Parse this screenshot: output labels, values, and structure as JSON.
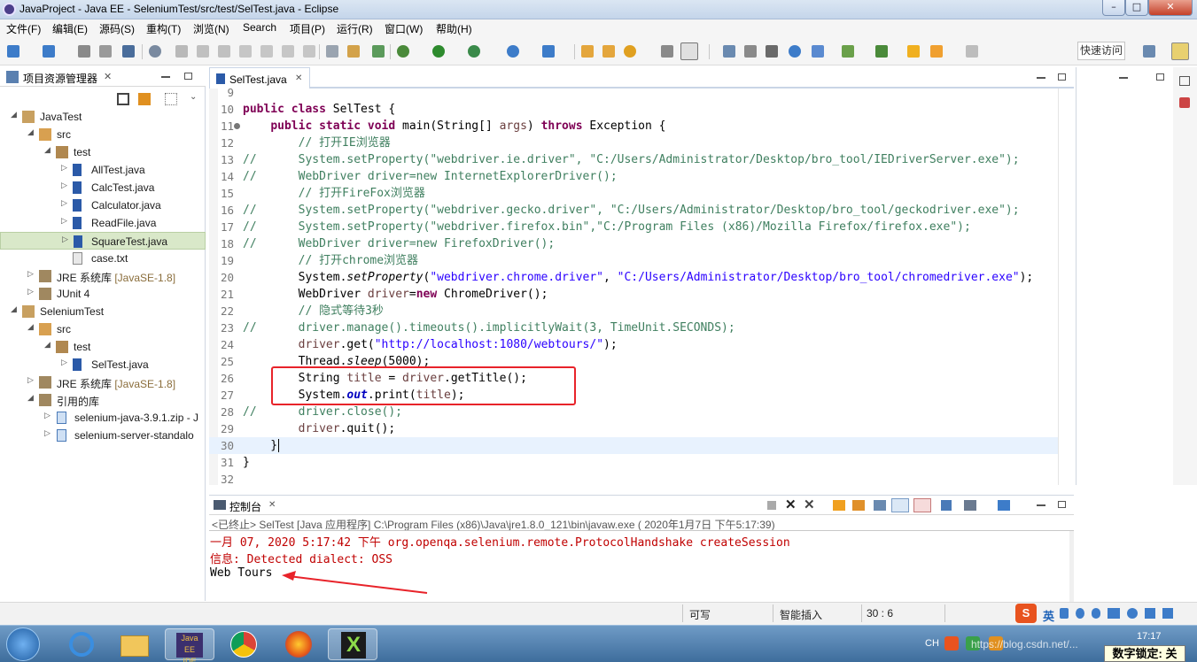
{
  "window": {
    "title": "JavaProject - Java EE - SeleniumTest/src/test/SelTest.java - Eclipse",
    "min_glyph": "–",
    "max_glyph": "□",
    "close_glyph": "✕"
  },
  "menubar": {
    "items": [
      "文件(F)",
      "编辑(E)",
      "源码(S)",
      "重构(T)",
      "浏览(N)",
      "Search",
      "项目(P)",
      "运行(R)",
      "窗口(W)",
      "帮助(H)"
    ]
  },
  "toolbar": {
    "quick_access_label": "快速访问"
  },
  "explorer": {
    "title": "项目资源管理器",
    "close_glyph": "✕",
    "rows": [
      {
        "label": "JavaTest",
        "suffix": ""
      },
      {
        "label": "src",
        "suffix": ""
      },
      {
        "label": "test",
        "suffix": ""
      },
      {
        "label": "AllTest.java",
        "suffix": ""
      },
      {
        "label": "CalcTest.java",
        "suffix": ""
      },
      {
        "label": "Calculator.java",
        "suffix": ""
      },
      {
        "label": "ReadFile.java",
        "suffix": ""
      },
      {
        "label": "SquareTest.java",
        "suffix": ""
      },
      {
        "label": "case.txt",
        "suffix": ""
      },
      {
        "label": "JRE 系统库 ",
        "suffix": "[JavaSE-1.8]"
      },
      {
        "label": "JUnit 4",
        "suffix": ""
      },
      {
        "label": "SeleniumTest",
        "suffix": ""
      },
      {
        "label": "src",
        "suffix": ""
      },
      {
        "label": "test",
        "suffix": ""
      },
      {
        "label": "SelTest.java",
        "suffix": ""
      },
      {
        "label": "JRE 系统库 ",
        "suffix": "[JavaSE-1.8]"
      },
      {
        "label": "引用的库",
        "suffix": ""
      },
      {
        "label": "selenium-java-3.9.1.zip - J",
        "suffix": ""
      },
      {
        "label": "selenium-server-standalo",
        "suffix": ""
      }
    ]
  },
  "editor": {
    "tab_label": "SelTest.java",
    "close_glyph": "✕",
    "line_numbers": [
      "9",
      "10",
      "11",
      "12",
      "13",
      "14",
      "15",
      "16",
      "17",
      "18",
      "19",
      "20",
      "21",
      "22",
      "23",
      "24",
      "25",
      "26",
      "27",
      "28",
      "29",
      "30",
      "31",
      "32"
    ],
    "code": {
      "l10_kw": "public class ",
      "l10_rest": "SelTest {",
      "l11_indent": "    ",
      "l11_kw": "public static void ",
      "l11_rest": "main(String[] ",
      "l11_var": "args",
      "l11_paren": ") ",
      "l11_kw2": "throws ",
      "l11_end": "Exception {",
      "l12_cm": "        // 打开IE浏览器",
      "l13_cm": "//      System.setProperty(\"webdriver.ie.driver\", \"C:/Users/Administrator/Desktop/bro_tool/IEDriverServer.exe\");",
      "l14_cm": "//      WebDriver driver=new InternetExplorerDriver();",
      "l15_cm": "        // 打开FireFox浏览器",
      "l16_cm": "//      System.setProperty(\"webdriver.gecko.driver\", \"C:/Users/Administrator/Desktop/bro_tool/geckodriver.exe\");",
      "l17_cm": "//      System.setProperty(\"webdriver.firefox.bin\",\"C:/Program Files (x86)/Mozilla Firefox/firefox.exe\");",
      "l18_cm": "//      WebDriver driver=new FirefoxDriver();",
      "l19_cm": "        // 打开chrome浏览器",
      "l20_a": "        System.",
      "l20_b": "setProperty",
      "l20_c": "(",
      "l20_s1": "\"webdriver.chrome.driver\"",
      "l20_d": ", ",
      "l20_s2": "\"C:/Users/Administrator/Desktop/bro_tool/chromedriver.exe\"",
      "l20_e": ");",
      "l21_a": "        WebDriver ",
      "l21_v": "driver",
      "l21_b": "=",
      "l21_kw": "new ",
      "l21_c": "ChromeDriver();",
      "l22_cm": "        // 隐式等待3秒",
      "l23_cm": "//      driver.manage().timeouts().implicitlyWait(3, TimeUnit.SECONDS);",
      "l24_a": "        ",
      "l24_v": "driver",
      "l24_b": ".get(",
      "l24_s": "\"http://localhost:1080/webtours/\"",
      "l24_c": ");",
      "l25_a": "        Thread.",
      "l25_b": "sleep",
      "l25_c": "(5000);",
      "l26_a": "        String ",
      "l26_v": "title",
      "l26_b": " = ",
      "l26_v2": "driver",
      "l26_c": ".getTitle();",
      "l27_a": "        System.",
      "l27_f": "out",
      "l27_b": ".print(",
      "l27_v": "title",
      "l27_c": ");",
      "l28_cm": "//      driver.close();",
      "l29_a": "        ",
      "l29_v": "driver",
      "l29_b": ".quit();",
      "l30": "    }",
      "l31": "}"
    }
  },
  "console": {
    "title": "控制台",
    "close_glyph": "✕",
    "terminated": "<已终止> SelTest [Java 应用程序] C:\\Program Files (x86)\\Java\\jre1.8.0_121\\bin\\javaw.exe ( 2020年1月7日 下午5:17:39)",
    "lines": [
      "一月 07, 2020 5:17:42 下午 org.openqa.selenium.remote.ProtocolHandshake createSession",
      "信息: Detected dialect: OSS",
      "Web Tours"
    ]
  },
  "statusbar": {
    "writable": "可写",
    "insert_mode": "智能插入",
    "position": "30 : 6"
  },
  "taskbar": {
    "ime_label": "英",
    "lang": "CH",
    "clock": "17:17",
    "numlock": "数字锁定: 关",
    "watermark": "https://blog.csdn.net/..."
  },
  "colors": {
    "highlight_box": "#e8232a",
    "arrow": "#e8232a",
    "console_error": "#c00000"
  }
}
